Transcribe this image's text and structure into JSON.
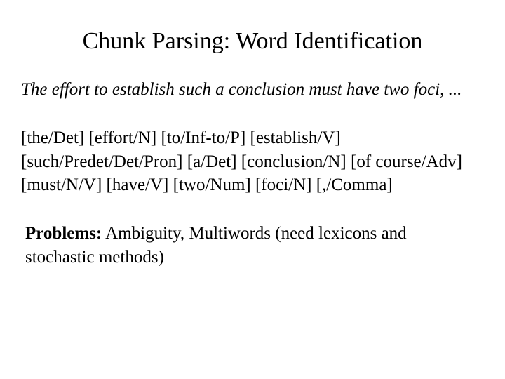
{
  "title": "Chunk Parsing: Word Identification",
  "example_sentence": "The effort to establish such a conclusion must have two foci, ...",
  "tagged_tokens": "[the/Det] [effort/N] [to/Inf-to/P] [establish/V] [such/Predet/Det/Pron] [a/Det] [conclusion/N] [of course/Adv] [must/N/V] [have/V] [two/Num] [foci/N] [,/Comma]",
  "problems": {
    "label": "Problems:",
    "text": "  Ambiguity, Multiwords (need lexicons and stochastic methods)"
  }
}
